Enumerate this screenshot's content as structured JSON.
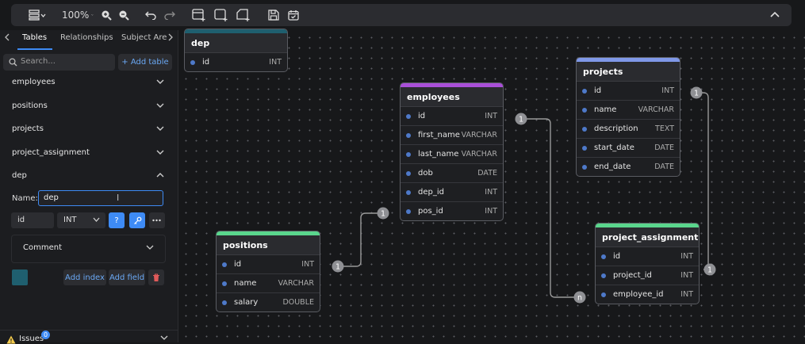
{
  "toolbar": {
    "zoom": "100%",
    "icons": [
      "layout-menu-icon",
      "zoom-in-icon",
      "zoom-out-icon",
      "undo-icon",
      "redo-icon",
      "add-table-icon",
      "add-area-icon",
      "add-note-icon",
      "save-icon",
      "calendar-icon",
      "collapse-icon"
    ]
  },
  "sidebar": {
    "tabs": [
      "Tables",
      "Relationships",
      "Subject Are"
    ],
    "search_placeholder": "Search...",
    "add_table": "+ Add table",
    "items": [
      "employees",
      "positions",
      "projects",
      "project_assignment",
      "dep"
    ],
    "editor": {
      "name_label": "Name:",
      "name_value": "dep",
      "field_name": "id",
      "field_type": "INT",
      "nullable_btn": "?",
      "comment_label": "Comment",
      "color": "#1f5f6f",
      "add_index": "Add index",
      "add_field": "Add field"
    },
    "issues_label": "Issues",
    "issues_count": "0"
  },
  "colors": {
    "accent": "#3e8bf5",
    "dep": "#1f5f6f",
    "employees": "#a94fd8",
    "projects": "#7f98e8",
    "positions": "#5ad68d",
    "project_assignment": "#5ad68d",
    "edge": "#9a9a9a"
  },
  "diagram": {
    "tables": [
      {
        "key": "dep",
        "name": "dep",
        "fields": [
          {
            "name": "id",
            "type": "INT"
          }
        ]
      },
      {
        "key": "employees",
        "name": "employees",
        "fields": [
          {
            "name": "id",
            "type": "INT"
          },
          {
            "name": "first_name",
            "type": "VARCHAR"
          },
          {
            "name": "last_name",
            "type": "VARCHAR"
          },
          {
            "name": "dob",
            "type": "DATE"
          },
          {
            "name": "dep_id",
            "type": "INT"
          },
          {
            "name": "pos_id",
            "type": "INT"
          }
        ]
      },
      {
        "key": "projects",
        "name": "projects",
        "fields": [
          {
            "name": "id",
            "type": "INT"
          },
          {
            "name": "name",
            "type": "VARCHAR"
          },
          {
            "name": "description",
            "type": "TEXT"
          },
          {
            "name": "start_date",
            "type": "DATE"
          },
          {
            "name": "end_date",
            "type": "DATE"
          }
        ]
      },
      {
        "key": "positions",
        "name": "positions",
        "fields": [
          {
            "name": "id",
            "type": "INT"
          },
          {
            "name": "name",
            "type": "VARCHAR"
          },
          {
            "name": "salary",
            "type": "DOUBLE"
          }
        ]
      },
      {
        "key": "project_assignment",
        "name": "project_assignment",
        "fields": [
          {
            "name": "id",
            "type": "INT"
          },
          {
            "name": "project_id",
            "type": "INT"
          },
          {
            "name": "employee_id",
            "type": "INT"
          }
        ]
      }
    ],
    "relationships": [
      {
        "from": "employees.id",
        "to": "project_assignment.employee_id",
        "from_card": "1",
        "to_card": "n"
      },
      {
        "from": "positions.id",
        "to": "employees.pos_id",
        "from_card": "1",
        "to_card": "1"
      },
      {
        "from": "projects.id",
        "to": "project_assignment.project_id",
        "from_card": "1",
        "to_card": "1"
      }
    ]
  }
}
